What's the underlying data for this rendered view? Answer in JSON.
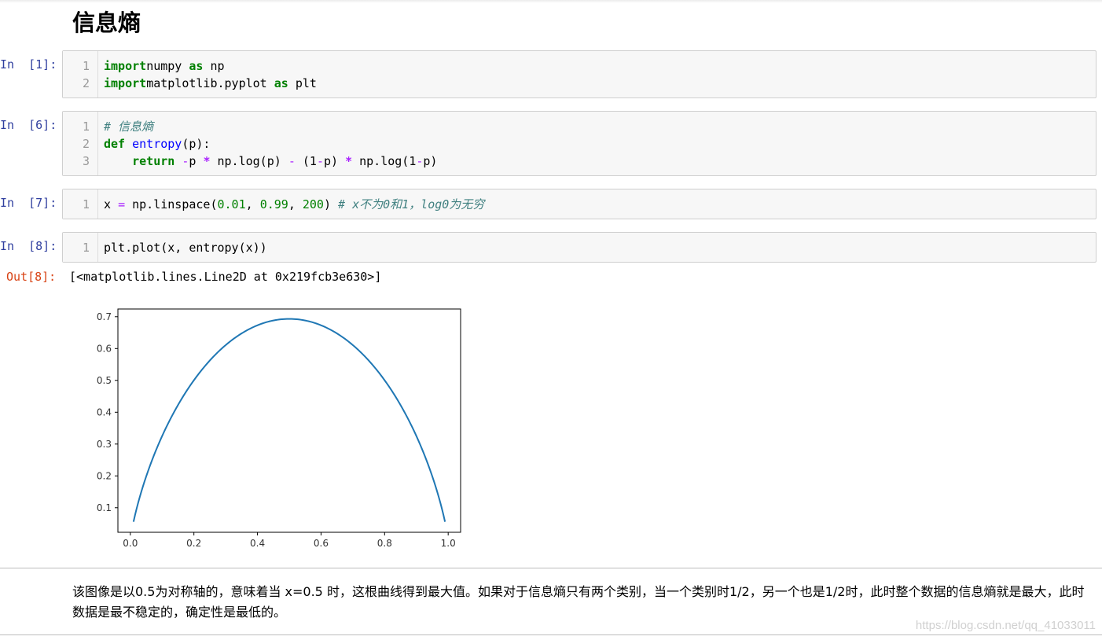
{
  "heading": "信息熵",
  "cells": [
    {
      "prompt": "In  [1]:",
      "lines": [
        {
          "n": "1",
          "parts": [
            [
              "kw",
              "import"
            ],
            [
              "",
              "numpy "
            ],
            [
              "kw",
              "as"
            ],
            [
              "",
              " np"
            ]
          ]
        },
        {
          "n": "2",
          "parts": [
            [
              "kw",
              "import"
            ],
            [
              "",
              "matplotlib.pyplot "
            ],
            [
              "kw",
              "as"
            ],
            [
              "",
              " plt"
            ]
          ]
        }
      ]
    },
    {
      "prompt": "In  [6]:",
      "lines": [
        {
          "n": "1",
          "parts": [
            [
              "cm",
              "# 信息熵"
            ]
          ]
        },
        {
          "n": "2",
          "parts": [
            [
              "kw",
              "def"
            ],
            [
              "",
              " "
            ],
            [
              "fn",
              "entropy"
            ],
            [
              "",
              "(p):"
            ]
          ]
        },
        {
          "n": "3",
          "parts": [
            [
              "",
              "    "
            ],
            [
              "kw",
              "return"
            ],
            [
              "",
              " "
            ],
            [
              "op",
              "-"
            ],
            [
              "",
              "p "
            ],
            [
              "op-magic",
              "*"
            ],
            [
              "",
              " np.log(p) "
            ],
            [
              "op",
              "-"
            ],
            [
              "",
              " (1"
            ],
            [
              "op",
              "-"
            ],
            [
              "",
              "p) "
            ],
            [
              "op-magic",
              "*"
            ],
            [
              "",
              " np.log(1"
            ],
            [
              "op",
              "-"
            ],
            [
              "",
              "p)"
            ]
          ]
        }
      ]
    },
    {
      "prompt": "In  [7]:",
      "lines": [
        {
          "n": "1",
          "parts": [
            [
              "",
              "x "
            ],
            [
              "op",
              "="
            ],
            [
              "",
              " np.linspace("
            ],
            [
              "num",
              "0.01"
            ],
            [
              "",
              ", "
            ],
            [
              "num",
              "0.99"
            ],
            [
              "",
              ", "
            ],
            [
              "num",
              "200"
            ],
            [
              "",
              ") "
            ],
            [
              "cm",
              "# x不为0和1，log0为无穷"
            ]
          ]
        }
      ]
    },
    {
      "prompt": "In  [8]:",
      "lines": [
        {
          "n": "1",
          "parts": [
            [
              "",
              "plt.plot(x, entropy(x))"
            ]
          ]
        }
      ]
    }
  ],
  "output": {
    "prompt": "Out[8]:",
    "text": "[<matplotlib.lines.Line2D at 0x219fcb3e630>]"
  },
  "chart_data": {
    "type": "line",
    "title": "",
    "xlabel": "",
    "ylabel": "",
    "xlim": [
      -0.0391,
      1.0391
    ],
    "ylim": [
      0.0229,
      0.7242
    ],
    "xticks": [
      "0.0",
      "0.2",
      "0.4",
      "0.6",
      "0.8",
      "1.0"
    ],
    "yticks": [
      "0.1",
      "0.2",
      "0.3",
      "0.4",
      "0.5",
      "0.6",
      "0.7"
    ],
    "series": [
      {
        "function": "-p*ln(p) - (1-p)*ln(1-p)",
        "x_start": 0.01,
        "x_end": 0.99,
        "n_points": 200,
        "color": "#1f77b4"
      }
    ],
    "grid": false
  },
  "markdown": "该图像是以0.5为对称轴的，意味着当 x=0.5 时，这根曲线得到最大值。如果对于信息熵只有两个类别，当一个类别时1/2，另一个也是1/2时，此时整个数据的信息熵就是最大，此时数据是最不稳定的，确定性是最低的。",
  "watermark": "https://blog.csdn.net/qq_41033011"
}
